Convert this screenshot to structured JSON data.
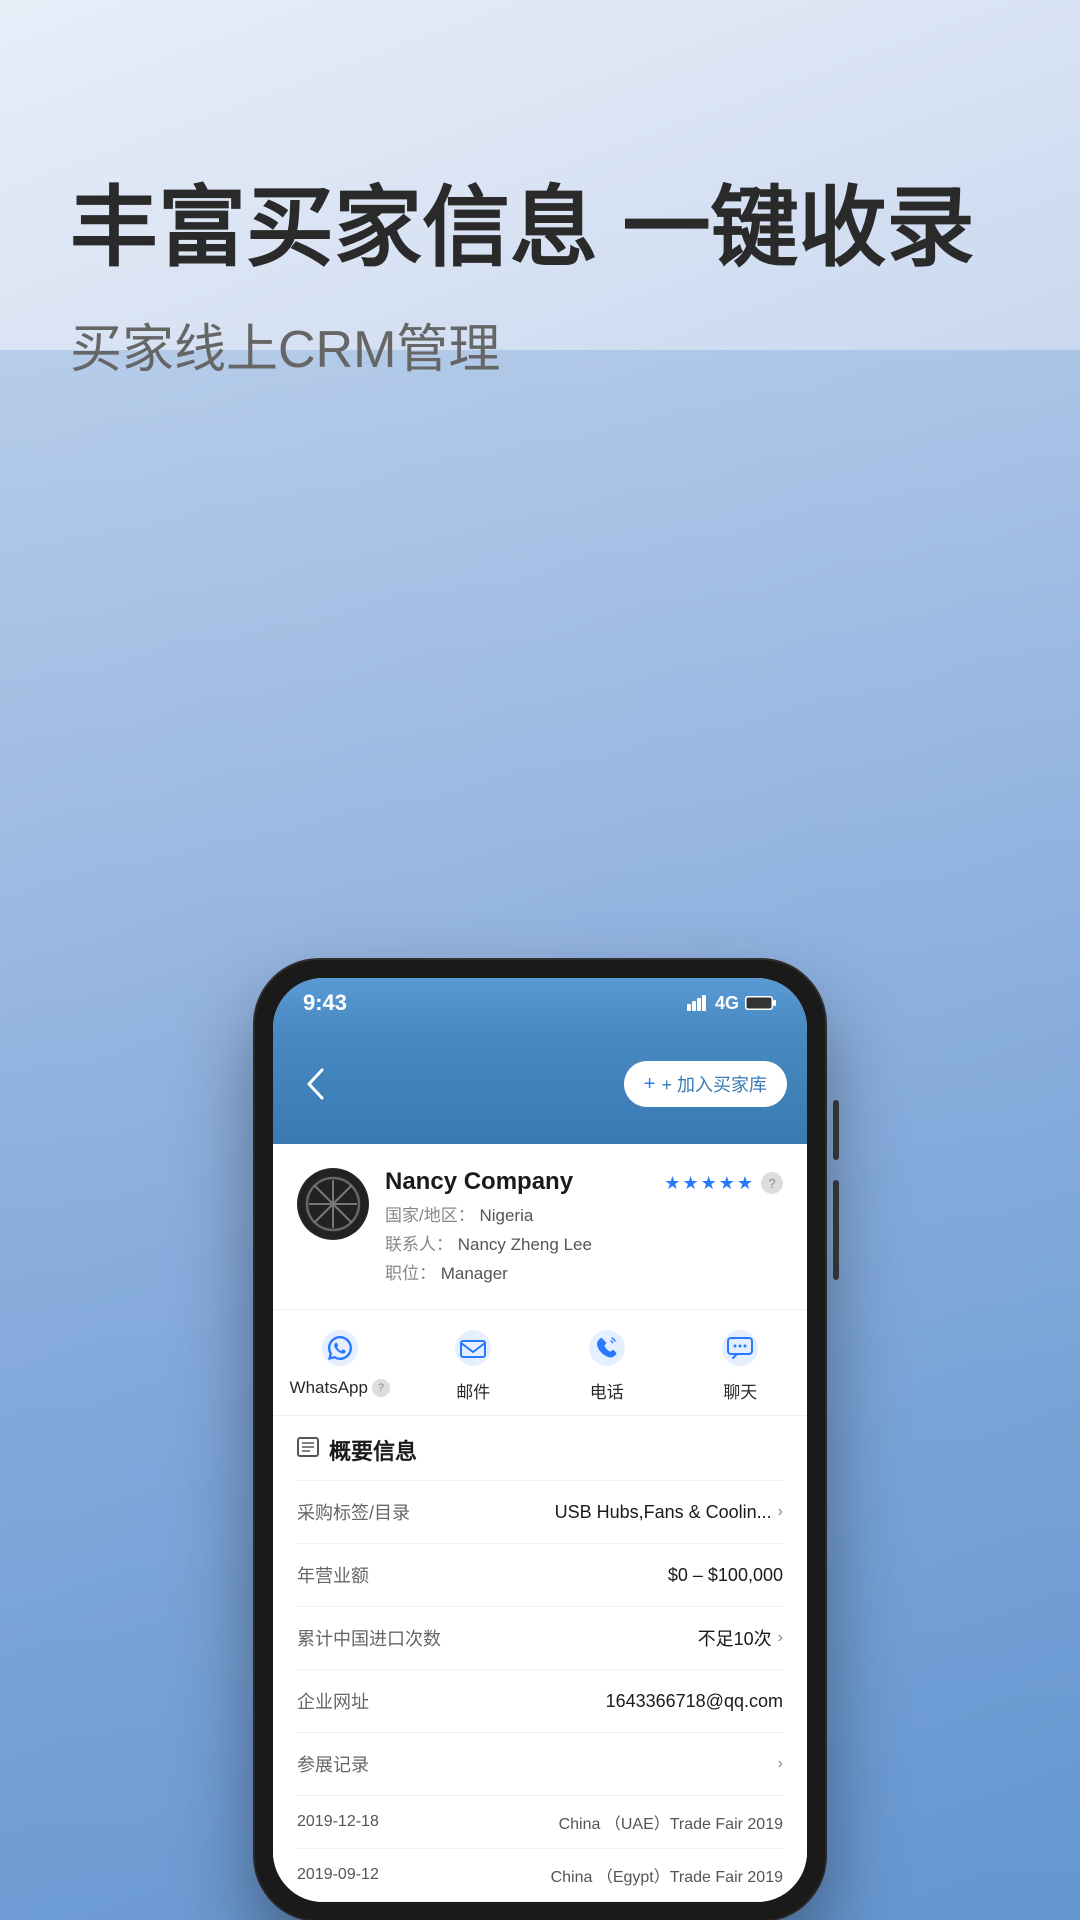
{
  "page": {
    "background_gradient_start": "#e8eef8",
    "background_gradient_end": "#7aaad8"
  },
  "header": {
    "main_title": "丰富买家信息 一键收录",
    "sub_title": "买家线上CRM管理"
  },
  "phone": {
    "status": {
      "time": "9:43",
      "signal": "4G"
    },
    "top_button": "+ 加入买家库",
    "back_icon": "‹",
    "company": {
      "name": "Nancy Company",
      "country_label": "国家/地区：",
      "country": "Nigeria",
      "contact_label": "联系人：",
      "contact": "Nancy Zheng Lee",
      "position_label": "职位：",
      "position": "Manager",
      "rating_stars": 5
    },
    "actions": [
      {
        "id": "whatsapp",
        "label": "WhatsApp",
        "has_question": true
      },
      {
        "id": "mail",
        "label": "邮件",
        "has_question": false
      },
      {
        "id": "phone",
        "label": "电话",
        "has_question": false
      },
      {
        "id": "chat",
        "label": "聊天",
        "has_question": false
      }
    ],
    "overview": {
      "section_title": "概要信息",
      "rows": [
        {
          "label": "采购标签/目录",
          "value": "USB Hubs,Fans & Coolin...",
          "has_arrow": true
        },
        {
          "label": "年营业额",
          "value": "$0 – $100,000",
          "has_arrow": false
        },
        {
          "label": "累计中国进口次数",
          "value": "不足10次",
          "has_arrow": true
        },
        {
          "label": "企业网址",
          "value": "1643366718@qq.com",
          "has_arrow": false
        },
        {
          "label": "参展记录",
          "value": "",
          "has_arrow": true
        }
      ],
      "trade_records": [
        {
          "date": "2019-12-18",
          "event": "China （UAE）Trade Fair 2019"
        },
        {
          "date": "2019-09-12",
          "event": "China （Egypt）Trade Fair 2019"
        }
      ]
    }
  }
}
